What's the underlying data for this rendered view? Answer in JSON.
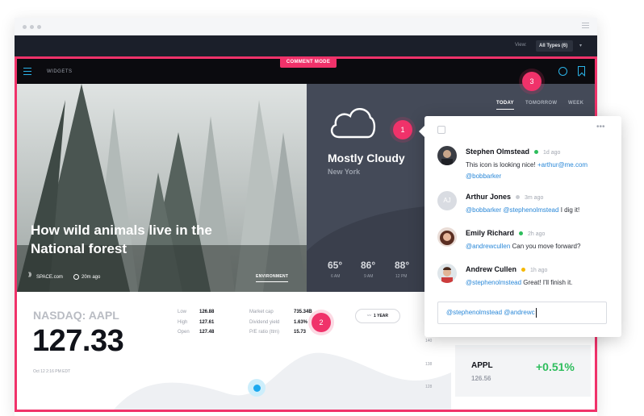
{
  "toolbar": {
    "view_label": "View:",
    "view_value": "All Types (6)",
    "view_caret": "▾"
  },
  "mode_badge": "COMMENT MODE",
  "appbar": {
    "title": "WIDGETS"
  },
  "article": {
    "title": "How wild animals live in the National forest",
    "source": "SPACE.com",
    "time": "20m ago",
    "tag": "ENVIRONMENT"
  },
  "weather": {
    "tabs": [
      "TODAY",
      "TOMORROW",
      "WEEK"
    ],
    "condition": "Mostly Cloudy",
    "city": "New York",
    "forecast": [
      {
        "temp": "65°",
        "time": "6 AM"
      },
      {
        "temp": "86°",
        "time": "9 AM"
      },
      {
        "temp": "88°",
        "time": "12 PM"
      }
    ]
  },
  "stock": {
    "ticker": "NASDAQ: AAPL",
    "price": "127.33",
    "date": "Oct 12 2:16 PM EDT",
    "stats_left": [
      {
        "label": "Low",
        "value": "126.88"
      },
      {
        "label": "High",
        "value": "127.61"
      },
      {
        "label": "Open",
        "value": "127.48"
      }
    ],
    "stats_right": [
      {
        "label": "Market cap",
        "value": "735.34B"
      },
      {
        "label": "Dividend yield",
        "value": "1.63%"
      },
      {
        "label": "P/E ratio (ttm)",
        "value": "15.73"
      }
    ],
    "range_button": "1 YEAR",
    "range_icon": "〰",
    "y_ticks": [
      "140",
      "138",
      "128"
    ]
  },
  "appl": {
    "ticker": "APPL",
    "price": "126.56",
    "change": "+0.51%"
  },
  "markers": [
    "1",
    "2",
    "3"
  ],
  "comments_panel": {
    "more": "•••",
    "comments": [
      {
        "author": "Stephen Olmstead",
        "status_color": "#2dbd5c",
        "time": "1d ago",
        "text": "This icon is looking nice!",
        "mention1": "+arthur@me.com",
        "mention2": "@bobbarker"
      },
      {
        "author": "Arthur Jones",
        "initials": "AJ",
        "status_color": "#c9ccd2",
        "time": "3m ago",
        "mention1": "@bobbarker",
        "mention2": "@stephenolmstead",
        "text": "I dig it!"
      },
      {
        "author": "Emily Richard",
        "status_color": "#2dbd5c",
        "time": "2h ago",
        "mention1": "@andrewcullen",
        "text": "Can you move forward?"
      },
      {
        "author": "Andrew Cullen",
        "status_color": "#f5b800",
        "time": "1h ago",
        "mention1": "@stephenolmstead",
        "text": "Great! I'll finish it."
      }
    ],
    "reply_value": "@stephenolmstead @andrewc"
  }
}
